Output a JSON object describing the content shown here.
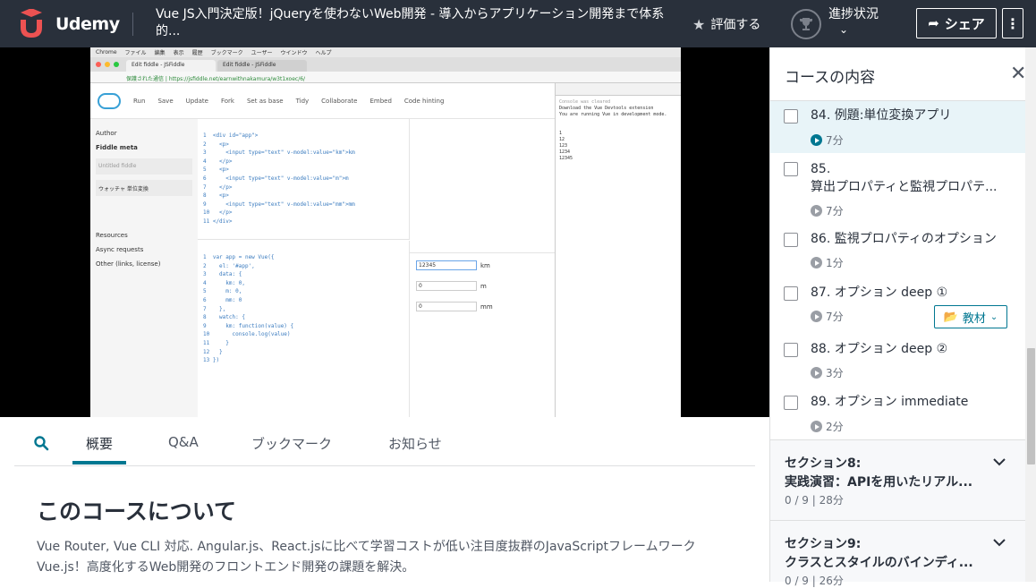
{
  "brand": {
    "name": "Udemy",
    "color": "#ec5252"
  },
  "header": {
    "course_title": "Vue JS入門決定版！jQueryを使わないWeb開発 - 導入からアプリケーション開発まで体系的...",
    "rate_label": "評価する",
    "progress_label": "進捗状況",
    "share_label": "シェア",
    "more_icon": "vertical-ellipsis-icon"
  },
  "video": {
    "mac_menu": [
      "Chrome",
      "ファイル",
      "編集",
      "表示",
      "履歴",
      "ブックマーク",
      "ユーザー",
      "ウインドウ",
      "ヘルプ"
    ],
    "browser_tabs": [
      "Edit fiddle - JSFiddle",
      "Edit fiddle - JSFiddle"
    ],
    "url": "保護された通信 | https://jsfiddle.net/earnwithnakamura/w3t1xoec/6/",
    "jsfiddle_toolbar": [
      "Run",
      "Save",
      "Update",
      "Fork",
      "Set as base",
      "Tidy",
      "Collaborate",
      "Embed",
      "Code hinting"
    ],
    "sidebar": {
      "author": "Author",
      "meta": "Fiddle meta",
      "untitled": "Untitled fiddle",
      "desc": "ウォッチャ 単位変換",
      "resources": "Resources",
      "async": "Async requests",
      "other": "Other (links, license)"
    },
    "html_code": "1  <div id=\"app\">\n2    <p>\n3      <input type=\"text\" v-model:value=\"km\">km\n4    </p>\n5    <p>\n6      <input type=\"text\" v-model:value=\"m\">m\n7    </p>\n8    <p>\n9      <input type=\"text\" v-model:value=\"mm\">mm\n10   </p>\n11 </div>",
    "js_code": "1  var app = new Vue({\n2    el: '#app',\n3    data: {\n4      km: 0,\n5      m: 0,\n6      mm: 0\n7    },\n8    watch: {\n9      km: function(value) {\n10       console.log(value)\n11     }\n12   }\n13 })",
    "result_inputs": [
      {
        "value": "12345",
        "unit": "km"
      },
      {
        "value": "0",
        "unit": "m"
      },
      {
        "value": "0",
        "unit": "mm"
      }
    ],
    "console_lines": [
      "Console was cleared",
      "Download the Vue Devtools extension",
      "You are running Vue in development mode.",
      "1",
      "12",
      "123",
      "1234",
      "12345"
    ]
  },
  "tabs": [
    {
      "label": "概要",
      "active": true
    },
    {
      "label": "Q&A"
    },
    {
      "label": "ブックマーク"
    },
    {
      "label": "お知らせ"
    }
  ],
  "about": {
    "title": "このコースについて",
    "desc_line1": "Vue Router, Vue CLI 対応. Angular.js、React.jsに比べて学習コストが低い注目度抜群のJavaScriptフレームワーク",
    "desc_line2": "Vue.js！高度化するWeb開発のフロントエンド開発の課題を解決。"
  },
  "sidebar": {
    "title": "コースの内容",
    "lectures": [
      {
        "title": "84. 例題:単位変換アプリ",
        "duration": "7分",
        "active": true
      },
      {
        "title": "85.\n算出プロパティと監視プロパテ...",
        "duration": "7分"
      },
      {
        "title": "86. 監視プロパティのオプション",
        "duration": "1分"
      },
      {
        "title": "87. オプション deep ①",
        "duration": "7分",
        "resource": "教材"
      },
      {
        "title": "88. オプション deep ②",
        "duration": "3分"
      },
      {
        "title": "89. オプション immediate",
        "duration": "2分"
      }
    ],
    "sections": [
      {
        "heading": "セクション8:",
        "title": "実践演習：APIを用いたリアル...",
        "meta": "0 / 9 | 28分"
      },
      {
        "heading": "セクション9:",
        "title": "クラスとスタイルのバインディ...",
        "meta": "0 / 9 | 26分"
      }
    ]
  }
}
